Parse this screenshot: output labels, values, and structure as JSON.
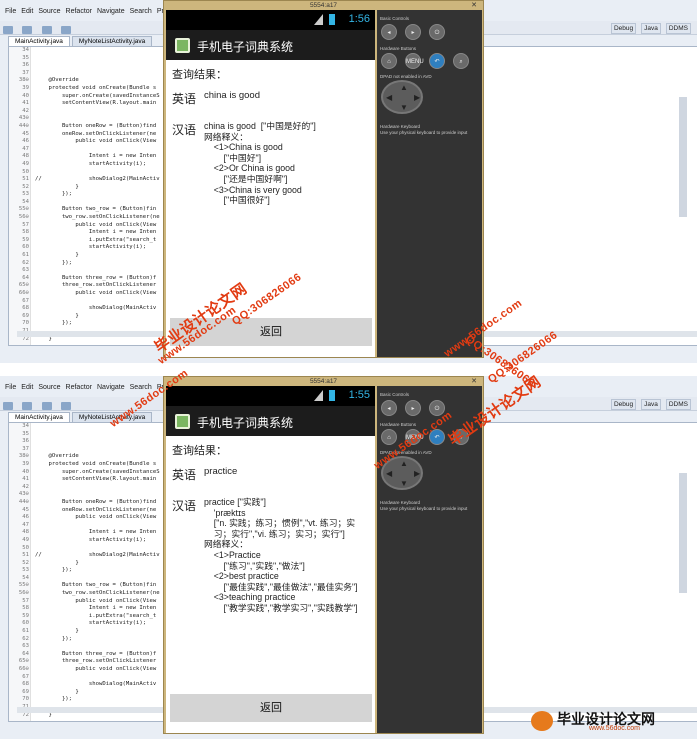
{
  "ide": {
    "menu": [
      "File",
      "Edit",
      "Source",
      "Refactor",
      "Navigate",
      "Search",
      "Project"
    ],
    "perspectives": [
      "Debug",
      "Java",
      "DDMS"
    ],
    "tabs": [
      "MainActivity.java",
      "MyNoteListActivity.java"
    ],
    "line_numbers": [
      "34",
      "35",
      "36",
      "37",
      "38⊖",
      "39",
      "40",
      "41",
      "42",
      "43⊖",
      "44⊖",
      "45",
      "46",
      "47",
      "48",
      "49",
      "50",
      "51",
      "52",
      "53",
      "54",
      "55⊖",
      "56⊖",
      "57",
      "58",
      "59",
      "60",
      "61",
      "62",
      "63",
      "64",
      "65⊖",
      "66⊖",
      "67",
      "68",
      "69",
      "70",
      "71",
      "72"
    ],
    "code_lines": [
      "",
      "",
      "",
      "",
      "    @Override",
      "    protected void onCreate(Bundle s",
      "        super.onCreate(savedInstanceS",
      "        setContentView(R.layout.main",
      "",
      "",
      "        Button oneRow = (Button)find",
      "        oneRow.setOnClickListener(ne",
      "            public void onClick(View",
      "",
      "                Intent i = new Inten",
      "                startActivity(i);",
      "",
      "//              showDialog2(MainActiv",
      "            }",
      "        });",
      "",
      "        Button two_row = (Button)fin",
      "        two_row.setOnClickListener(ne",
      "            public void onClick(View",
      "                Intent i = new Inten",
      "                i.putExtra(\"search_t",
      "                startActivity(i);",
      "            }",
      "        });",
      "",
      "        Button three_row = (Button)f",
      "        three_row.setOnClickListener",
      "            public void onClick(View",
      "",
      "                showDialog(MainActiv",
      "            }",
      "        });",
      "",
      "    }"
    ]
  },
  "screens": [
    {
      "emulator_title": "5554:a17",
      "clock": "1:56",
      "app_title": "手机电子词典系统",
      "query_label": "查询结果：",
      "en_label": "英语",
      "en_value": "china is good",
      "zh_label": "汉语",
      "zh_body": "china is good  [\"中国是好的\"]\n网络释义：\n    <1>China is good\n        [\"中国好\"]\n    <2>Or China is good\n        [\"还是中国好啊\"]\n    <3>China is very good\n        [\"中国很好\"]",
      "back_label": "返回"
    },
    {
      "emulator_title": "5554:a17",
      "clock": "1:55",
      "app_title": "手机电子词典系统",
      "query_label": "查询结果：",
      "en_label": "英语",
      "en_value": "practice",
      "zh_label": "汉语",
      "zh_body": "practice [\"实践\"]\n    'præktɪs\n    [\"n. 实践；练习；惯例\",\"vt. 练习；实\n    习；实行\",\"vi. 练习；实习；实行\"]\n网络释义：\n    <1>Practice\n        [\"练习\",\"实践\",\"做法\"]\n    <2>best practice\n        [\"最佳实践\",\"最佳做法\",\"最佳实务\"]\n    <3>teaching practice\n        [\"教学实践\",\"教学实习\",\"实践教学\"]",
      "back_label": "返回"
    }
  ],
  "controls": {
    "basic_controls": "Basic Controls",
    "hardware_buttons": "Hardware Buttons",
    "dpad_note": "DPAD not enabled in AVD",
    "keyboard_title": "Hardware Keyboard",
    "keyboard_note": "Use your physical keyboard to provide input",
    "menu_label": "MENU"
  },
  "watermarks": {
    "url": "www.56doc.com",
    "qq": "QQ:306826066",
    "brand": "毕业设计论文网"
  },
  "footer": {
    "brand": "毕业设计论文网",
    "url": "www.56doc.com"
  },
  "colors": {
    "accent_blue": "#33b5e5",
    "watermark_red": "#e23b12",
    "emulator_frame": "#cdb67d"
  }
}
